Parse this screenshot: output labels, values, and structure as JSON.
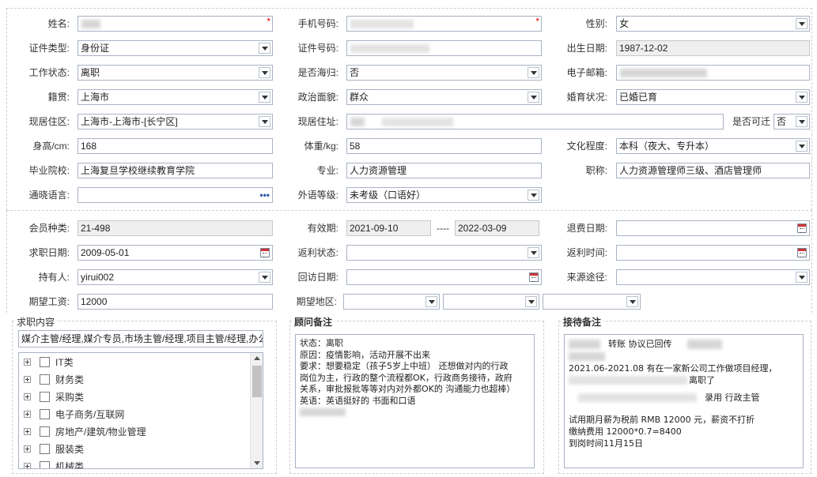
{
  "basic": {
    "name": {
      "label": "姓名:",
      "required": "*"
    },
    "phone": {
      "label": "手机号码:",
      "required": "*"
    },
    "gender": {
      "label": "性别:",
      "value": "女"
    },
    "id_type": {
      "label": "证件类型:",
      "value": "身份证"
    },
    "id_number": {
      "label": "证件号码:"
    },
    "birth_date": {
      "label": "出生日期:",
      "value": "1987-12-02"
    },
    "work_status": {
      "label": "工作状态:",
      "value": "离职"
    },
    "overseas_return": {
      "label": "是否海归:",
      "value": "否"
    },
    "email": {
      "label": "电子邮箱:"
    },
    "native_place": {
      "label": "籍贯:",
      "value": "上海市"
    },
    "political": {
      "label": "政治面貌:",
      "value": "群众"
    },
    "marital": {
      "label": "婚育状况:",
      "value": "已婚已育"
    },
    "residence_area": {
      "label": "现居住区:",
      "value": "上海市-上海市-[长宁区]"
    },
    "address": {
      "label": "现居住址:"
    },
    "relocate": {
      "label": "是否可迁",
      "value": "否"
    },
    "height": {
      "label": "身高/cm:",
      "value": "168"
    },
    "weight": {
      "label": "体重/kg:",
      "value": "58"
    },
    "education": {
      "label": "文化程度:",
      "value": "本科（夜大、专升本）"
    },
    "school": {
      "label": "毕业院校:",
      "value": "上海复旦学校继续教育学院"
    },
    "major": {
      "label": "专业:",
      "value": "人力资源管理"
    },
    "title": {
      "label": "职称:",
      "value": "人力资源管理师三级、酒店管理师"
    },
    "languages": {
      "label": "通晓语言:",
      "value": "",
      "more": "•••"
    },
    "foreign_level": {
      "label": "外语等级:",
      "value": "未考级（口语好）"
    }
  },
  "member": {
    "member_type": {
      "label": "会员种类:",
      "value": "21-498"
    },
    "validity": {
      "label": "有效期:",
      "from": "2021-09-10",
      "sep": "----",
      "to": "2022-03-09"
    },
    "refund_date": {
      "label": "退费日期:",
      "value": ""
    },
    "apply_date": {
      "label": "求职日期:",
      "value": "2009-05-01"
    },
    "rebate_status": {
      "label": "返利状态:",
      "value": ""
    },
    "rebate_time": {
      "label": "返利时间:",
      "value": ""
    },
    "holder": {
      "label": "持有人:",
      "value": "yirui002"
    },
    "visit_date": {
      "label": "回访日期:",
      "value": ""
    },
    "source": {
      "label": "来源途径:",
      "value": ""
    },
    "expected_salary": {
      "label": "期望工资:",
      "value": "12000"
    },
    "expected_area": {
      "label": "期望地区:",
      "values": [
        "",
        "",
        ""
      ]
    }
  },
  "job_content": {
    "title": "求职内容",
    "summary": "媒介主管/经理,媒介专员,市场主管/经理,项目主管/经理,办公",
    "tree": [
      "IT类",
      "财务类",
      "采购类",
      "电子商务/互联网",
      "房地产/建筑/物业管理",
      "服装类",
      "机械类"
    ]
  },
  "advisor_notes": {
    "title": "顾问备注",
    "lines": [
      "状态：离职",
      "原因：疫情影响，活动开展不出来",
      "要求：想要稳定（孩子5岁上中班） 还想做对内的行政",
      "岗位为主，行政的整个流程都OK，行政商务接待，政府",
      "关系，审批报批等等对内对外都OK的 沟通能力也超棒）",
      "英语：英语挺好的 书面和口语"
    ]
  },
  "reception_notes": {
    "title": "接待备注",
    "l1": "转账 协议已回传",
    "l2": "2021.06-2021.08 有在一家新公司工作做项目经理，",
    "l3": "离职了",
    "l4": "录用 行政主管",
    "l5": "试用期月薪为税前 RMB 12000 元，薪资不打折",
    "l6": "缴纳费用 12000*0.7=8400",
    "l7": "到岗时间11月15日"
  },
  "icons": {
    "dropdown": "chevron-down-icon",
    "calendar": "calendar-icon",
    "expand": "plus-square-icon"
  }
}
